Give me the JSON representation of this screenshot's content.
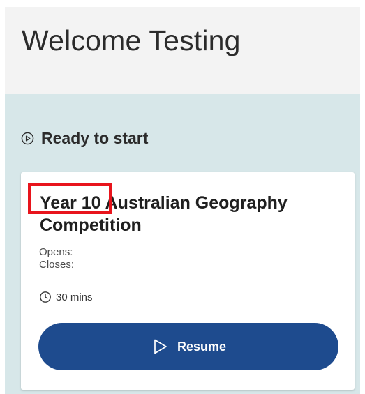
{
  "header": {
    "welcome_text": "Welcome Testing"
  },
  "section": {
    "title": "Ready to start",
    "icon": "play-circle-icon"
  },
  "card": {
    "title": "Year 10 Australian Geography Competition",
    "opens_label": "Opens:",
    "closes_label": "Closes:",
    "duration": "30 mins",
    "duration_icon": "clock-icon",
    "resume_label": "Resume",
    "resume_icon": "play-outline-icon"
  },
  "colors": {
    "header_bg": "#f3f3f3",
    "main_bg": "#d7e7e9",
    "button_bg": "#1e4b8e",
    "highlight": "#e8141c"
  }
}
